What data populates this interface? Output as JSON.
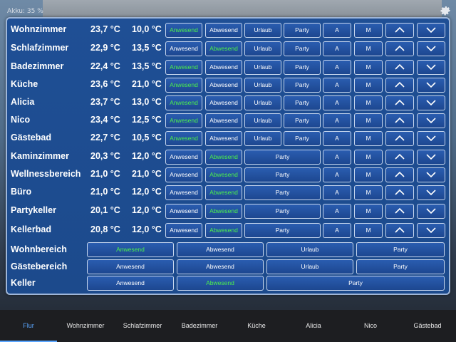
{
  "status": {
    "battery": "Akku: 35 %"
  },
  "rooms": [
    {
      "name": "Wohnzimmer",
      "current": "23,7 °C",
      "target": "10,0 °C",
      "mode": "full",
      "buttons": [
        "Anwesend",
        "Abwesend",
        "Urlaub",
        "Party",
        "A",
        "M"
      ],
      "active": 0
    },
    {
      "name": "Schlafzimmer",
      "current": "22,9 °C",
      "target": "13,5 °C",
      "mode": "full",
      "buttons": [
        "Anwesend",
        "Abwesend",
        "Urlaub",
        "Party",
        "A",
        "M"
      ],
      "active": 1
    },
    {
      "name": "Badezimmer",
      "current": "22,4 °C",
      "target": "13,5 °C",
      "mode": "full",
      "buttons": [
        "Anwesend",
        "Abwesend",
        "Urlaub",
        "Party",
        "A",
        "M"
      ],
      "active": 0
    },
    {
      "name": "Küche",
      "current": "23,6 °C",
      "target": "21,0 °C",
      "mode": "full",
      "buttons": [
        "Anwesend",
        "Abwesend",
        "Urlaub",
        "Party",
        "A",
        "M"
      ],
      "active": 0
    },
    {
      "name": "Alicia",
      "current": "23,7 °C",
      "target": "13,0 °C",
      "mode": "full",
      "buttons": [
        "Anwesend",
        "Abwesend",
        "Urlaub",
        "Party",
        "A",
        "M"
      ],
      "active": 0
    },
    {
      "name": "Nico",
      "current": "23,4 °C",
      "target": "12,5 °C",
      "mode": "full",
      "buttons": [
        "Anwesend",
        "Abwesend",
        "Urlaub",
        "Party",
        "A",
        "M"
      ],
      "active": 0
    },
    {
      "name": "Gästebad",
      "current": "22,7 °C",
      "target": "10,5 °C",
      "mode": "full",
      "buttons": [
        "Anwesend",
        "Abwesend",
        "Urlaub",
        "Party",
        "A",
        "M"
      ],
      "active": 0
    },
    {
      "name": "Kaminzimmer",
      "current": "20,3 °C",
      "target": "12,0 °C",
      "mode": "short",
      "buttons": [
        "Anwesend",
        "Abwesend",
        "Party",
        "A",
        "M"
      ],
      "active": 1
    },
    {
      "name": "Wellnessbereich",
      "current": "21,0 °C",
      "target": "21,0 °C",
      "mode": "short",
      "buttons": [
        "Anwesend",
        "Abwesend",
        "Party",
        "A",
        "M"
      ],
      "active": 1
    },
    {
      "name": "Büro",
      "current": "21,0 °C",
      "target": "12,0 °C",
      "mode": "short",
      "buttons": [
        "Anwesend",
        "Abwesend",
        "Party",
        "A",
        "M"
      ],
      "active": 1
    },
    {
      "name": "Partykeller",
      "current": "20,1 °C",
      "target": "12,0 °C",
      "mode": "short",
      "buttons": [
        "Anwesend",
        "Abwesend",
        "Party",
        "A",
        "M"
      ],
      "active": 1
    },
    {
      "name": "Kellerbad",
      "current": "20,8 °C",
      "target": "12,0 °C",
      "mode": "short",
      "buttons": [
        "Anwesend",
        "Abwesend",
        "Party",
        "A",
        "M"
      ],
      "active": 1
    }
  ],
  "groups": [
    {
      "name": "Wohnbereich",
      "mode": "full",
      "buttons": [
        "Anwesend",
        "Abwesend",
        "Urlaub",
        "Party"
      ],
      "active": 0
    },
    {
      "name": "Gästebereich",
      "mode": "full",
      "buttons": [
        "Anwesend",
        "Abwesend",
        "Urlaub",
        "Party"
      ],
      "active": -1
    },
    {
      "name": "Keller",
      "mode": "short",
      "buttons": [
        "Anwesend",
        "Abwesend",
        "Party"
      ],
      "active": 1
    }
  ],
  "nav": {
    "active": 0,
    "items": [
      "Flur",
      "Wohnzimmer",
      "Schlafzimmer",
      "Badezimmer",
      "Küche",
      "Alicia",
      "Nico",
      "Gästebad"
    ]
  },
  "colors": {
    "active_text": "#4cf04c",
    "nav_active": "#5aa6ff",
    "panel_bg": "#1f4f95"
  },
  "icons": {
    "up": "chevron-up-icon",
    "down": "chevron-down-icon",
    "settings": "gear-icon"
  }
}
